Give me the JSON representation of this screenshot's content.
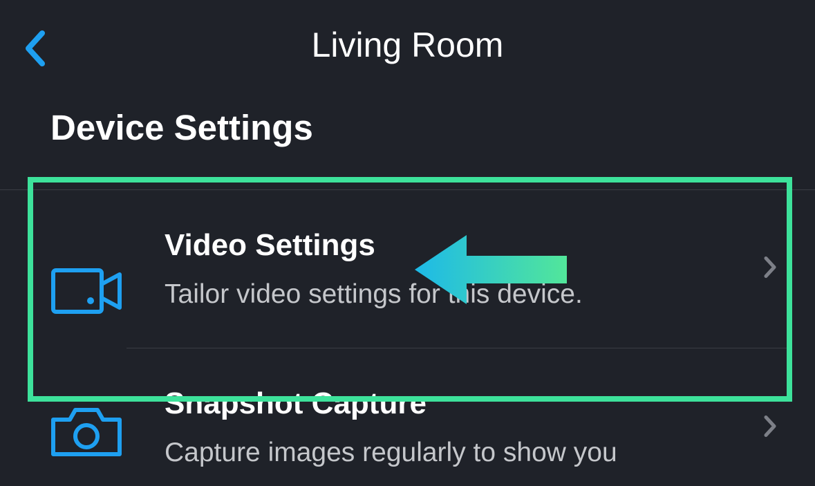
{
  "header": {
    "title": "Living Room"
  },
  "section": {
    "title": "Device Settings"
  },
  "items": [
    {
      "title": "Video Settings",
      "subtitle": "Tailor video settings for this device."
    },
    {
      "title": "Snapshot Capture",
      "subtitle": "Capture images regularly to show you"
    }
  ]
}
